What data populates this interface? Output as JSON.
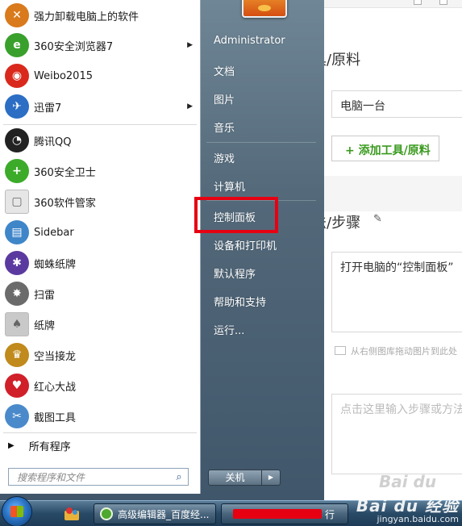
{
  "editor": {
    "tools_section_title": "工具/原料",
    "tool_item_value": "电脑一台",
    "add_tool_button": "+ 添加工具/原料",
    "steps_section_title": "方法/步骤",
    "step1_text": "打开电脑的“控制面板”",
    "drag_hint": "从右侧图库拖动图片到此处",
    "step2_placeholder": "点击这里输入步骤或方法"
  },
  "start_menu": {
    "programs": [
      {
        "label": "强力卸载电脑上的软件",
        "icon": "uninstall-icon",
        "color": "#d97a1c",
        "has_submenu": false
      },
      {
        "label": "360安全浏览器7",
        "icon": "360-browser-icon",
        "color": "#3aa02c",
        "has_submenu": true
      },
      {
        "label": "Weibo2015",
        "icon": "weibo-icon",
        "color": "#d9291c",
        "has_submenu": false
      },
      {
        "label": "迅雷7",
        "icon": "xunlei-icon",
        "color": "#2b6ec4",
        "has_submenu": true
      },
      {
        "label": "腾讯QQ",
        "icon": "qq-penguin-icon",
        "color": "#222222",
        "has_submenu": false
      },
      {
        "label": "360安全卫士",
        "icon": "360-guard-icon",
        "color": "#3cab2a",
        "has_submenu": false
      },
      {
        "label": "360软件管家",
        "icon": "360-software-icon",
        "color": "#e6e6e6",
        "has_submenu": false
      },
      {
        "label": "Sidebar",
        "icon": "sidebar-icon",
        "color": "#3f86c9",
        "has_submenu": false
      },
      {
        "label": "蜘蛛纸牌",
        "icon": "spider-solitaire-icon",
        "color": "#5b3aa0",
        "has_submenu": false
      },
      {
        "label": "扫雷",
        "icon": "minesweeper-icon",
        "color": "#6b6b6b",
        "has_submenu": false
      },
      {
        "label": "纸牌",
        "icon": "solitaire-icon",
        "color": "#c9c9c9",
        "has_submenu": false
      },
      {
        "label": "空当接龙",
        "icon": "freecell-icon",
        "color": "#c08a1c",
        "has_submenu": false
      },
      {
        "label": "红心大战",
        "icon": "hearts-icon",
        "color": "#d0202a",
        "has_submenu": false
      },
      {
        "label": "截图工具",
        "icon": "snipping-tool-icon",
        "color": "#4a8acb",
        "has_submenu": false
      }
    ],
    "all_programs": "所有程序",
    "search_placeholder": "搜索程序和文件",
    "right_items": [
      "Administrator",
      "文档",
      "图片",
      "音乐",
      "游戏",
      "计算机",
      "控制面板",
      "设备和打印机",
      "默认程序",
      "帮助和支持",
      "运行..."
    ],
    "highlighted_item": "控制面板",
    "shutdown_label": "关机"
  },
  "taskbar": {
    "active_window": "高级编辑器_百度经...",
    "redacted_window_suffix": "行"
  },
  "watermark": {
    "brand": "Bai du 经验",
    "url": "jingyan.baidu.com"
  }
}
